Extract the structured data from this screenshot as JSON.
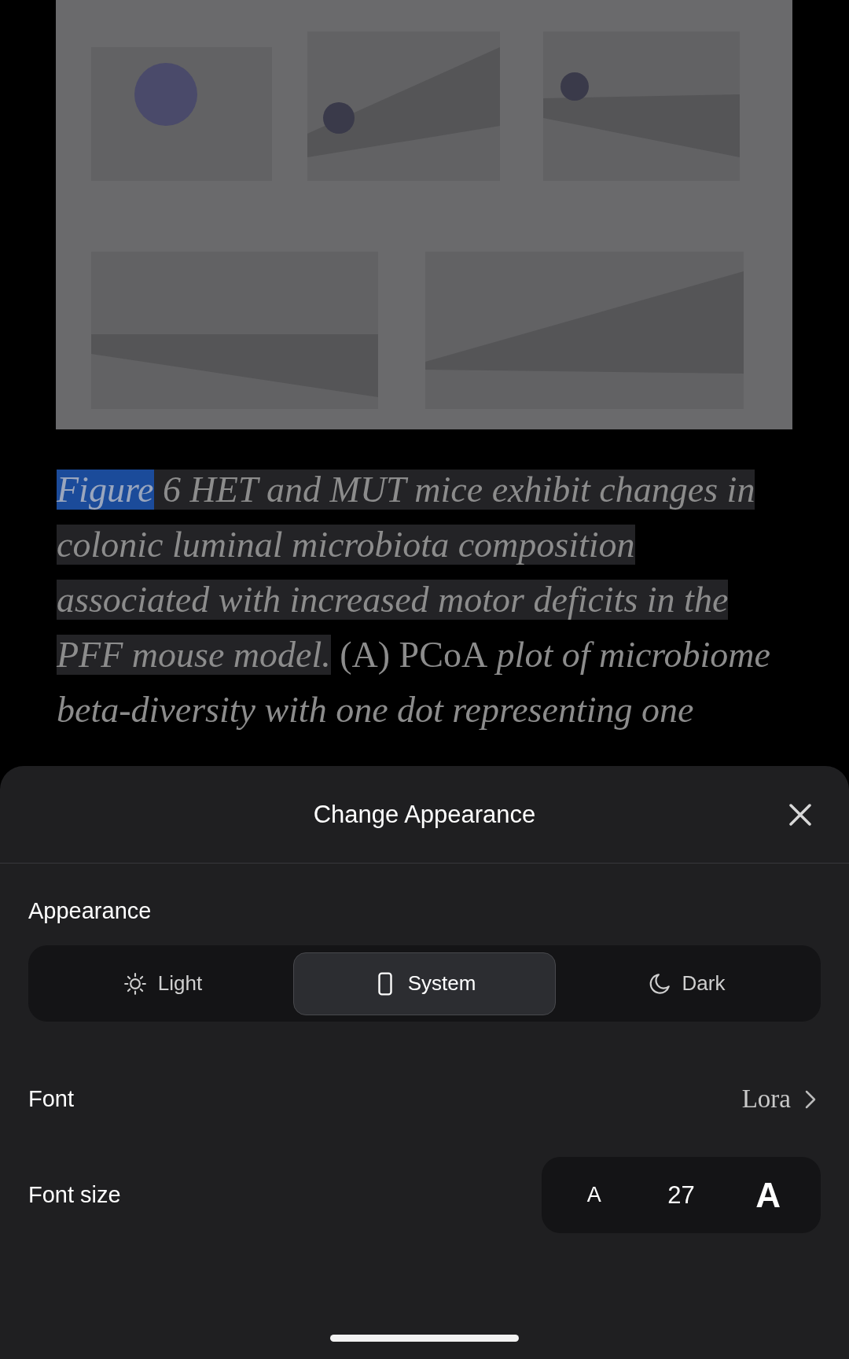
{
  "article": {
    "figure": {
      "kind": "picture"
    },
    "caption": [
      [
        {
          "text": "Figure",
          "selected": true,
          "italic": true
        },
        {
          "text": " 6 HET and MUT mice exhibit changes in",
          "selected": false,
          "highlighted": true,
          "italic": true
        }
      ],
      [
        {
          "text": "colonic luminal microbiota composition",
          "selected": false,
          "highlighted": true,
          "italic": true
        }
      ],
      [
        {
          "text": "associated with increased motor deficits in the",
          "selected": false,
          "highlighted": true,
          "italic": true
        }
      ],
      [
        {
          "text": "PFF mouse model.",
          "selected": false,
          "highlighted": true,
          "italic": true
        },
        {
          "text": " (A) PCoA",
          "selected": false,
          "highlighted": false,
          "italic": false
        },
        {
          "text": " plot of microbiome",
          "selected": false,
          "highlighted": false,
          "italic": true
        }
      ],
      [
        {
          "text": "beta-diversity with one dot representing one",
          "selected": false,
          "highlighted": false,
          "italic": true
        }
      ]
    ]
  },
  "sheet": {
    "title": "Change Appearance",
    "appearance": {
      "label": "Appearance",
      "options": [
        {
          "label": "Light",
          "kind": "sun",
          "selected": false
        },
        {
          "label": "System",
          "kind": "phone",
          "selected": true
        },
        {
          "label": "Dark",
          "kind": "moon",
          "selected": false
        }
      ]
    },
    "font": {
      "label": "Font",
      "value": "Lora"
    },
    "font_size": {
      "label": "Font size",
      "decrease": "A",
      "value": "27",
      "increase": "A"
    }
  }
}
